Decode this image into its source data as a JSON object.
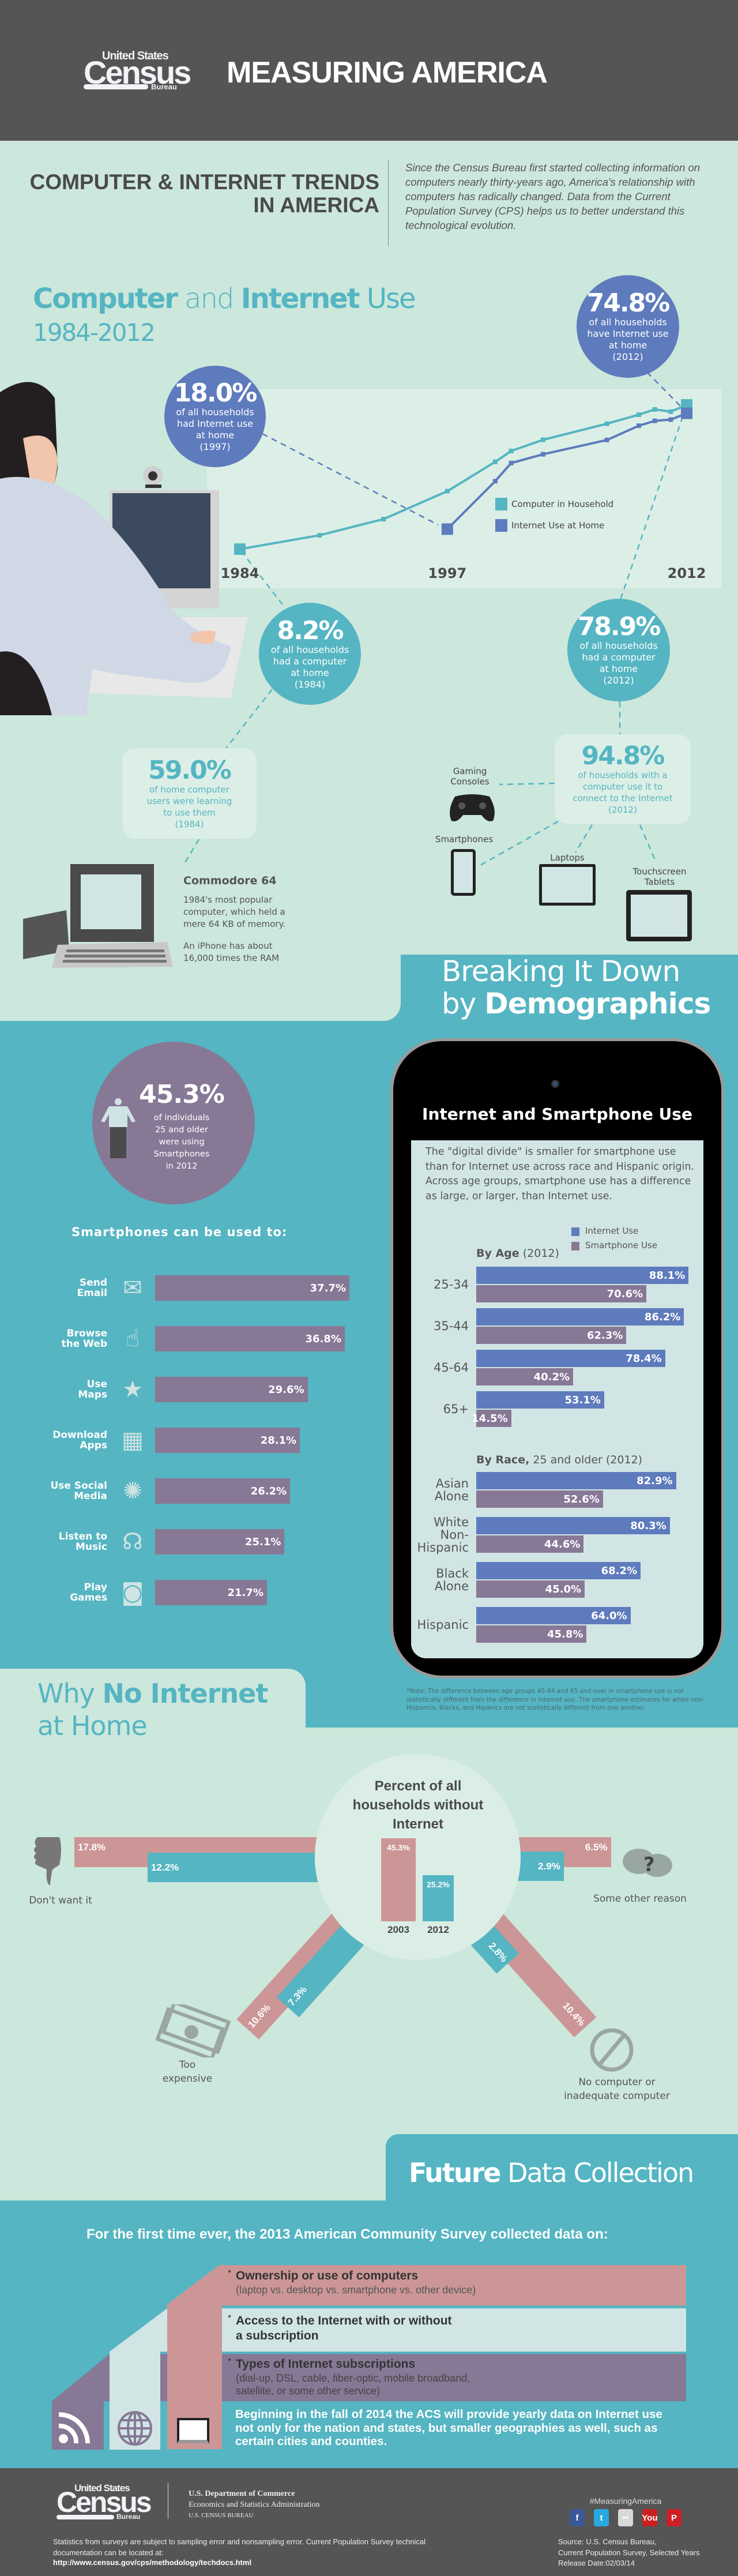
{
  "header": {
    "logo": {
      "top": "United States",
      "main": "Census",
      "bottom": "Bureau"
    },
    "title": "MEASURING AMERICA"
  },
  "intro": {
    "title_line1": "COMPUTER & INTERNET TRENDS",
    "title_line2": "IN AMERICA",
    "text": "Since the Census Bureau first started collecting information on computers nearly thirty-years ago, America's relationship with computers has radically changed.  Data from the Current Population Survey (CPS) helps us to better understand this technological evolution."
  },
  "trends": {
    "title_bold1": "Computer",
    "title_mid": " and ",
    "title_bold2": "Internet",
    "title_end": " Use",
    "years": "1984-2012",
    "callouts": {
      "internet_1997": {
        "value": "18.0%",
        "text": "of all households\nhad Internet use\nat home\n(1997)"
      },
      "internet_2012": {
        "value": "74.8%",
        "text": "of all households\nhave Internet use\nat home\n(2012)"
      },
      "computer_1984": {
        "value": "8.2%",
        "text": "of all households\nhad a computer\nat home\n(1984)"
      },
      "computer_2012": {
        "value": "78.9%",
        "text": "of all households\nhad a computer\nat home\n(2012)"
      },
      "learning_1984": {
        "value": "59.0%",
        "text": "of home computer\nusers were learning\nto use them\n(1984)"
      },
      "connect_2012": {
        "value": "94.8%",
        "text": "of households with a\ncomputer use it to\nconnect to the Internet\n(2012)"
      }
    },
    "commodore": {
      "title": "Commodore 64",
      "desc": "1984's most popular\ncomputer, which held a\nmere 64 KB of memory.",
      "note": "An iPhone has about\n16,000 times the RAM"
    },
    "devices": {
      "gaming": "Gaming\nConsoles",
      "smartphones": "Smartphones",
      "laptops": "Laptops",
      "tablets": "Touchscreen\nTablets"
    }
  },
  "demographics": {
    "title_line1": "Breaking It Down",
    "title_by": "by ",
    "title_bold": "Demographics",
    "highlight": {
      "value": "45.3%",
      "text": "of individuals\n25 and older\nwere using\nSmartphones\nin 2012"
    },
    "uses_icons": [
      "envelope-icon",
      "touch-browser-icon",
      "map-star-icon",
      "app-download-icon",
      "social-network-icon",
      "headphones-icon",
      "game-controller-icon"
    ],
    "phone": {
      "title": "Internet and Smartphone Use",
      "text": "The \"digital divide\" is smaller for smartphone use than for Internet use across race and Hispanic origin.  Across age groups, smartphone use has a difference as large, or larger, than Internet use.",
      "age_title_bold": "By Age",
      "age_title_rest": " (2012)",
      "race_title_bold": "By Race,",
      "race_title_rest": " 25 and older (2012)"
    },
    "note": "*Note: The difference between age groups 45-64 and 65 and over in smartphone use is not statistically different from the difference in Internet use.  The smartphone estimates for white non-Hispanics, Blacks, and Hipanics are not statistically different from one another."
  },
  "no_internet": {
    "title_why": "Why ",
    "title_bold": "No Internet",
    "title_end": "at Home",
    "center_title": "Percent of all\nhouseholds without\nInternet"
  },
  "future": {
    "title_bold": "Future",
    "title_rest": " Data Collection",
    "intro": "For the first time ever, the 2013 American Community Survey collected data on:",
    "items": [
      {
        "title": "Ownership or use of computers",
        "detail": "(laptop vs. desktop vs. smartphone vs. other device)"
      },
      {
        "title": "Access to the Internet with or without\na subscription",
        "detail": ""
      },
      {
        "title": "Types of Internet subscriptions",
        "detail": "(dial-up, DSL, cable, fiber-optic, mobile broadband,\nsatellite, or some other service)"
      }
    ],
    "bullet": "*",
    "closing": "Beginning in the fall of 2014 the ACS will provide yearly data on Internet use\nnot only for the nation and states, but smaller geographies as well, such as\ncertain cities and counties."
  },
  "footer": {
    "logo": {
      "top": "United States",
      "main": "Census",
      "bottom": "Bureau"
    },
    "dept1": "U.S. Department of Commerce",
    "dept2": "Economics and Statistics Administration",
    "dept3": "U.S. CENSUS BUREAU",
    "hashtag": "#MeasuringAmerica",
    "social": [
      {
        "name": "facebook",
        "glyph": "f",
        "color": "#3b5998"
      },
      {
        "name": "twitter",
        "glyph": "t",
        "color": "#29a9e1"
      },
      {
        "name": "flickr",
        "glyph": "••",
        "color": "#d8d8d8"
      },
      {
        "name": "youtube",
        "glyph": "You",
        "color": "#cc2020"
      },
      {
        "name": "pinterest",
        "glyph": "P",
        "color": "#cb2027"
      }
    ],
    "disclaimer": "Statistics from surveys are subject to sampling error and nonsampling error.  Current Population Survey technical\ndocumentation can be located at:",
    "link": "http://www.census.gov/cps/methodology/techdocs.html",
    "source": "Source:  U.S. Census Bureau,\nCurrent Population Survey, Selected Years\nRelease Date:02/03/14"
  },
  "colors": {
    "mint": "#cce7dc",
    "teal": "#55b5c2",
    "blue": "#5e7bbd",
    "purple": "#877896",
    "pink": "#cc9696",
    "dark": "#555555"
  },
  "chart_data": [
    {
      "type": "line",
      "title": "",
      "x": [
        1984,
        1989,
        1993,
        1997,
        2000,
        2001,
        2003,
        2007,
        2009,
        2010,
        2011,
        2012
      ],
      "xticks": [
        1984,
        1997,
        2012
      ],
      "series": [
        {
          "name": "Computer in Household",
          "color": "#55b5c2",
          "values": [
            8.2,
            15.0,
            22.9,
            36.6,
            51.0,
            56.3,
            61.8,
            69.7,
            74.1,
            76.7,
            75.6,
            78.9
          ]
        },
        {
          "name": "Internet Use at Home",
          "color": "#5e7bbd",
          "values": [
            null,
            null,
            null,
            18.0,
            41.5,
            50.4,
            54.7,
            61.7,
            68.7,
            71.1,
            71.7,
            74.8
          ]
        }
      ],
      "legend": "center-right",
      "grid": false
    },
    {
      "type": "bar",
      "orientation": "horizontal",
      "title": "Smartphones can be used to:",
      "categories": [
        "Send\nEmail",
        "Browse\nthe Web",
        "Use\nMaps",
        "Download\nApps",
        "Use Social\nMedia",
        "Listen to\nMusic",
        "Play\nGames"
      ],
      "values": [
        37.7,
        36.8,
        29.6,
        28.1,
        26.2,
        25.1,
        21.7
      ],
      "color": "#877896"
    },
    {
      "type": "bar",
      "orientation": "horizontal",
      "title": "By Age (2012)",
      "categories": [
        "25-34",
        "35-44",
        "45-64",
        "65+"
      ],
      "series": [
        {
          "name": "Internet Use",
          "color": "#5e7bbd",
          "values": [
            88.1,
            86.2,
            78.4,
            53.1
          ]
        },
        {
          "name": "Smartphone Use",
          "color": "#877896",
          "values": [
            70.6,
            62.3,
            40.2,
            14.5
          ]
        }
      ],
      "legend": "top-right"
    },
    {
      "type": "bar",
      "orientation": "horizontal",
      "title": "By Race, 25 and older (2012)",
      "categories": [
        "Asian\nAlone",
        "White\nNon-\nHispanic",
        "Black\nAlone",
        "Hispanic"
      ],
      "series": [
        {
          "name": "Internet Use",
          "color": "#5e7bbd",
          "values": [
            82.9,
            80.3,
            68.2,
            64.0
          ]
        },
        {
          "name": "Smartphone Use",
          "color": "#877896",
          "values": [
            52.6,
            44.6,
            45.0,
            45.8
          ]
        }
      ]
    },
    {
      "type": "bar",
      "title": "Percent of all households without Internet",
      "categories": [
        "2003",
        "2012"
      ],
      "values": [
        45.3,
        25.2
      ],
      "colors": [
        "#cc9696",
        "#55b5c2"
      ]
    },
    {
      "type": "bar",
      "title": "Why No Internet at Home",
      "categories": [
        "Don't want it",
        "Too\nexpensive",
        "Some other reason",
        "No computer or\ninadequate computer"
      ],
      "series": [
        {
          "name": "2003",
          "color": "#cc9696",
          "values": [
            17.8,
            10.6,
            6.5,
            10.4
          ]
        },
        {
          "name": "2012",
          "color": "#55b5c2",
          "values": [
            12.2,
            7.3,
            2.9,
            2.8
          ]
        }
      ]
    }
  ]
}
